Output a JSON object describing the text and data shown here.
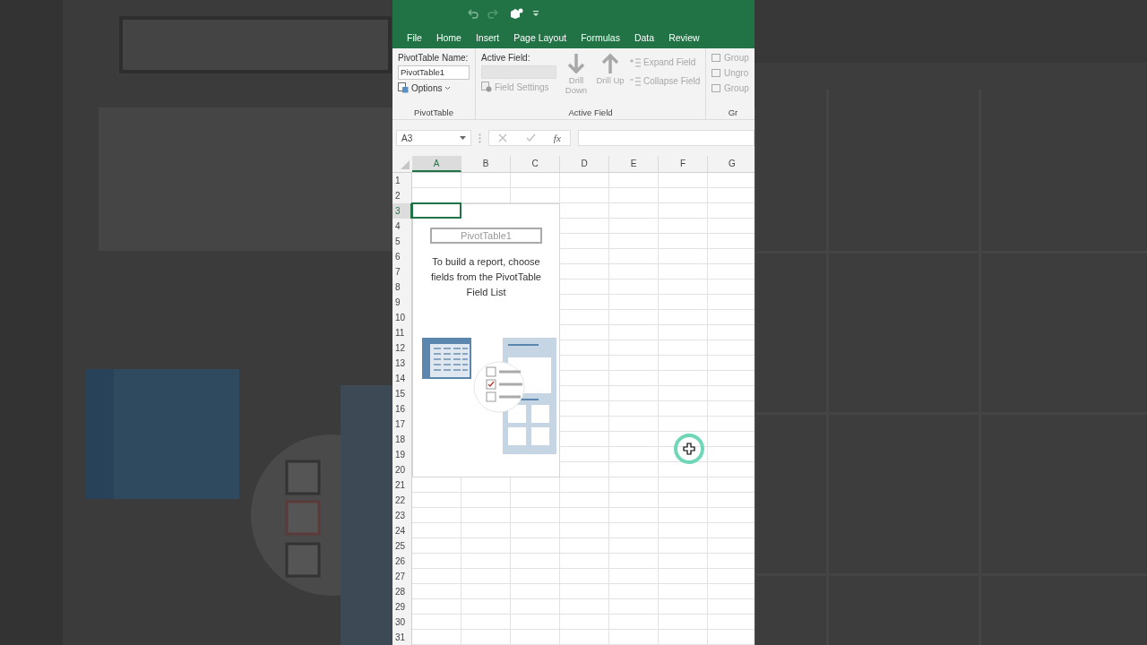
{
  "ribbon_tabs": [
    "File",
    "Home",
    "Insert",
    "Page Layout",
    "Formulas",
    "Data",
    "Review"
  ],
  "ribbon": {
    "pivottable_group": {
      "title": "PivotTable",
      "name_label": "PivotTable Name:",
      "name_value": "PivotTable1",
      "options_label": "Options"
    },
    "active_field_group": {
      "title": "Active Field",
      "field_label": "Active Field:",
      "disabled": true,
      "field_settings": "Field Settings",
      "drill_down": "Drill Down",
      "drill_up": "Drill Up",
      "expand_field": "Expand Field",
      "collapse_field": "Collapse Field"
    },
    "group_group": {
      "title": "Gr",
      "items": [
        "Group",
        "Ungro",
        "Group"
      ]
    }
  },
  "formula_bar": {
    "name_box": "A3",
    "function_glyph": "fx"
  },
  "sheet": {
    "columns": [
      {
        "label": "A",
        "selected": true
      },
      {
        "label": "B",
        "selected": false
      },
      {
        "label": "C",
        "selected": false
      },
      {
        "label": "D",
        "selected": false
      },
      {
        "label": "E",
        "selected": false
      },
      {
        "label": "F",
        "selected": false
      },
      {
        "label": "G",
        "selected": false
      }
    ],
    "rows": [
      {
        "label": "1",
        "selected": false
      },
      {
        "label": "2",
        "selected": false
      },
      {
        "label": "3",
        "selected": true
      },
      {
        "label": "4",
        "selected": false
      },
      {
        "label": "5",
        "selected": false
      },
      {
        "label": "6",
        "selected": false
      },
      {
        "label": "7",
        "selected": false
      },
      {
        "label": "8",
        "selected": false
      },
      {
        "label": "9",
        "selected": false
      },
      {
        "label": "10",
        "selected": false
      },
      {
        "label": "11",
        "selected": false
      },
      {
        "label": "12",
        "selected": false
      },
      {
        "label": "13",
        "selected": false
      },
      {
        "label": "14",
        "selected": false
      },
      {
        "label": "15",
        "selected": false
      },
      {
        "label": "16",
        "selected": false
      },
      {
        "label": "17",
        "selected": false
      },
      {
        "label": "18",
        "selected": false
      },
      {
        "label": "19",
        "selected": false
      },
      {
        "label": "20",
        "selected": false
      },
      {
        "label": "21",
        "selected": false
      },
      {
        "label": "22",
        "selected": false
      },
      {
        "label": "23",
        "selected": false
      },
      {
        "label": "24",
        "selected": false
      },
      {
        "label": "25",
        "selected": false
      },
      {
        "label": "26",
        "selected": false
      },
      {
        "label": "27",
        "selected": false
      },
      {
        "label": "28",
        "selected": false
      },
      {
        "label": "29",
        "selected": false
      },
      {
        "label": "30",
        "selected": false
      },
      {
        "label": "31",
        "selected": false
      }
    ]
  },
  "pivot_placeholder": {
    "name": "PivotTable1",
    "message": "To build a report, choose fields from the PivotTable Field List"
  }
}
